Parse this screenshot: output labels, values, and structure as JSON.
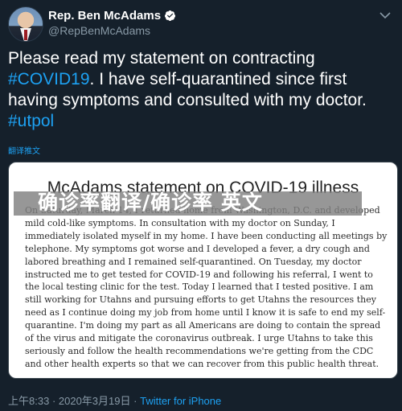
{
  "author": {
    "name": "Rep. Ben McAdams",
    "handle": "@RepBenMcAdams",
    "verified": true
  },
  "tweet": {
    "text_before": "Please read my statement on contracting ",
    "hashtag1": "#COVID19",
    "text_middle": ". I have self-quarantined since first having symptoms and consulted with my doctor. ",
    "hashtag2": "#utpol",
    "translate_label": "翻译推文"
  },
  "media": {
    "title": "McAdams statement on COVID-19 illness",
    "body": "On Saturday, March 14, I returned home from Washington, D.C. and developed mild cold-like symptoms. In consultation with my doctor on Sunday, I immediately isolated myself in my home. I have been conducting all meetings by telephone. My symptoms got worse and I developed a fever, a dry cough and labored breathing and I remained self-quarantined. On Tuesday, my doctor instructed me to get tested for COVID-19 and following his referral, I went to the local testing clinic for the test. Today I learned that I tested positive.  I am still working for Utahns and pursuing efforts to get Utahns the resources they need as I continue doing my job from home until I know it is safe to end my self-quarantine. I'm doing my part as all Americans are doing to contain the spread of the virus and mitigate the coronavirus outbreak. I urge Utahns to take this seriously and follow the health recommendations we're getting from the CDC and other health experts so that we can recover from this public health threat."
  },
  "overlay": {
    "text": "确诊率翻译/确诊率 英文"
  },
  "footer": {
    "time": "上午8:33",
    "date": "2020年3月19日",
    "separator": " · ",
    "source": "Twitter for iPhone"
  },
  "colors": {
    "background": "#15202b",
    "link": "#1da1f2",
    "muted": "#8899a6"
  }
}
